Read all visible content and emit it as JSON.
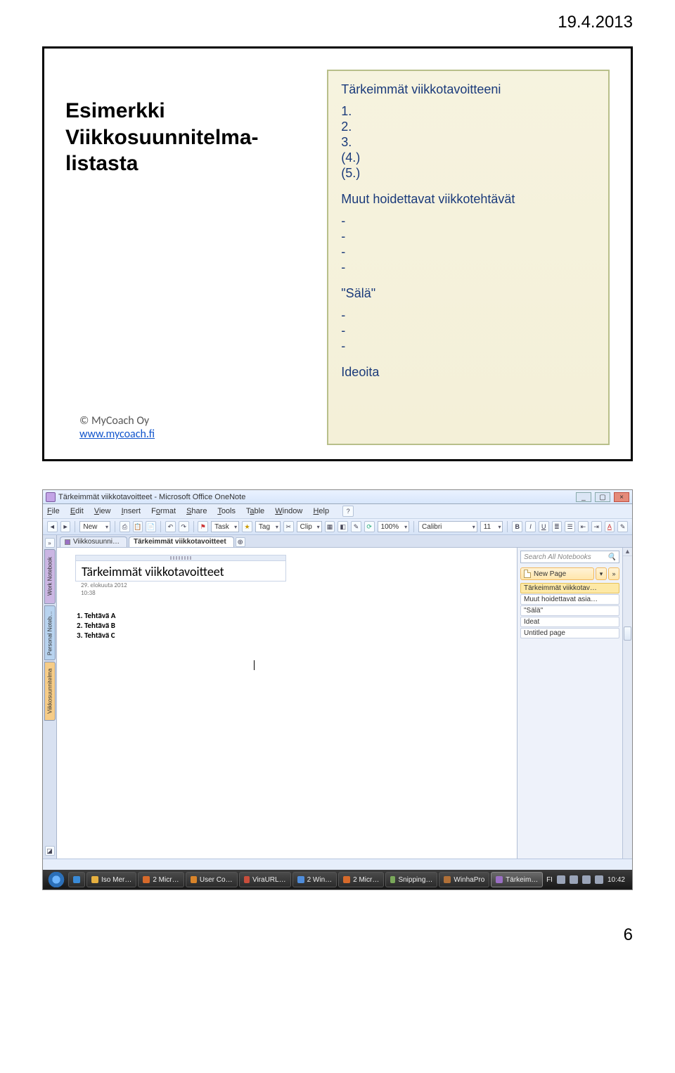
{
  "page_header_date": "19.4.2013",
  "page_number": "6",
  "slide1": {
    "left_title_l1": "Esimerkki",
    "left_title_l2": "Viikkosuunnitelma-",
    "left_title_l3": "listasta",
    "copyright": "© MyCoach Oy",
    "url": "www.mycoach.fi",
    "box": {
      "h_goals": "Tärkeimmät viikkotavoitteeni",
      "g1": "1.",
      "g2": "2.",
      "g3": "3.",
      "g4": "(4.)",
      "g5": "(5.)",
      "h_tasks": "Muut hoidettavat viikkotehtävät",
      "t1": "-",
      "t2": "-",
      "t3": "-",
      "t4": "-",
      "h_sala": "\"Sälä\"",
      "s1": "-",
      "s2": "-",
      "s3": "-",
      "h_ideas": "Ideoita"
    }
  },
  "onenote": {
    "window_title": "Tärkeimmät viikkotavoitteet - Microsoft Office OneNote",
    "menu": {
      "file": "File",
      "edit": "Edit",
      "view": "View",
      "insert": "Insert",
      "format": "Format",
      "share": "Share",
      "tools": "Tools",
      "table": "Table",
      "window": "Window",
      "help": "Help"
    },
    "toolbar": {
      "new": "New",
      "task": "Task",
      "tag": "Tag",
      "clip": "Clip",
      "zoom": "100%",
      "font": "Calibri",
      "fontsize": "11"
    },
    "notebooks": {
      "nb1": "Work Notebook",
      "nb2": "Personal Noteb…",
      "nb3": "Viikkosuunnitelma"
    },
    "sections": {
      "tab1": "Viikkosuunni…",
      "tab2": "Tärkeimmät viikkotavoitteet"
    },
    "search_placeholder": "Search All Notebooks",
    "newpage_label": "New Page",
    "pages": {
      "p1": "Tärkeimmät viikkotav…",
      "p2": "Muut hoidettavat asia…",
      "p3": "\"Sälä\"",
      "p4": "Ideat",
      "p5": "Untitled page"
    },
    "note": {
      "title": "Tärkeimmät viikkotavoitteet",
      "date": "29. elokuuta 2012",
      "time": "10:38",
      "task1": "1.   Tehtävä A",
      "task2": "2.   Tehtävä B",
      "task3": "3.   Tehtävä C"
    },
    "lang": "FI",
    "clock": "10:42",
    "task_apps": {
      "a1": "Iso Mer…",
      "a2": "2 Micr…",
      "a3": "User Co…",
      "a4": "ViraURL…",
      "a5": "2 Win…",
      "a6": "2 Micr…",
      "a7": "Snipping…",
      "a8": "WinhaPro",
      "a9": "Tärkeim…"
    }
  }
}
